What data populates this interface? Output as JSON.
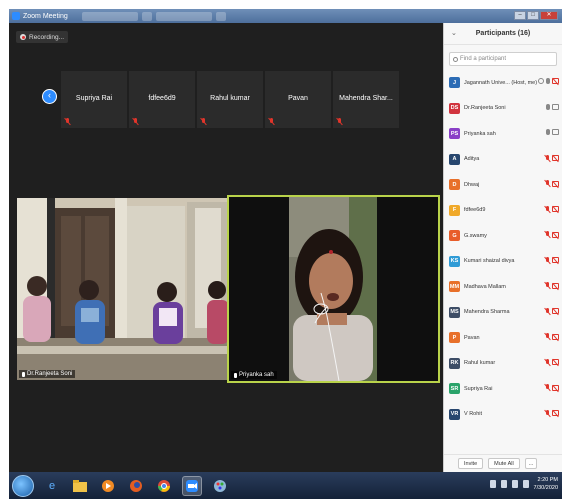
{
  "window": {
    "title": "Zoom Meeting"
  },
  "recording": {
    "label": "Recording..."
  },
  "thumbnails": [
    {
      "name": "Supriya Rai"
    },
    {
      "name": "fdfee6d9"
    },
    {
      "name": "Rahul kumar"
    },
    {
      "name": "Pavan"
    },
    {
      "name": "Mahendra  Shar..."
    }
  ],
  "videos": [
    {
      "label": "Dr.Ranjeeta Soni"
    },
    {
      "label": "Priyanka sah"
    }
  ],
  "panel": {
    "title": "Participants (16)",
    "search_placeholder": "Find a participant",
    "invite_label": "Invite",
    "mute_all_label": "Mute All",
    "more_label": "...",
    "participants": [
      {
        "initials": "J",
        "name": "Jagannath Unive... (Host, me)",
        "color": "#2c6cb5",
        "mic": "on",
        "cam": "off",
        "host": true
      },
      {
        "initials": "DS",
        "name": "Dr.Ranjeeta Soni",
        "color": "#d1343e",
        "mic": "on",
        "cam": "on"
      },
      {
        "initials": "PS",
        "name": "Priyanka sah",
        "color": "#8a3fc7",
        "mic": "on",
        "cam": "on"
      },
      {
        "initials": "A",
        "name": "Aditya",
        "color": "#27466e",
        "mic": "off",
        "cam": "off"
      },
      {
        "initials": "D",
        "name": "Dhwaj",
        "color": "#e8702a",
        "mic": "off",
        "cam": "off"
      },
      {
        "initials": "F",
        "name": "fdfee6d9",
        "color": "#f0a92a",
        "mic": "off",
        "cam": "off"
      },
      {
        "initials": "G",
        "name": "G.swamy",
        "color": "#e85d2a",
        "mic": "off",
        "cam": "off"
      },
      {
        "initials": "KS",
        "name": "Kumari shaizal divya",
        "color": "#2f9bd6",
        "mic": "off",
        "cam": "off"
      },
      {
        "initials": "MM",
        "name": "Madhava Mallam",
        "color": "#e8702a",
        "mic": "off",
        "cam": "off"
      },
      {
        "initials": "MS",
        "name": "Mahendra Sharma",
        "color": "#3d4d66",
        "mic": "off",
        "cam": "off"
      },
      {
        "initials": "P",
        "name": "Pavan",
        "color": "#e8702a",
        "mic": "off",
        "cam": "off"
      },
      {
        "initials": "RK",
        "name": "Rahul kumar",
        "color": "#3d4d66",
        "mic": "off",
        "cam": "off"
      },
      {
        "initials": "SR",
        "name": "Supriya Rai",
        "color": "#2aa36a",
        "mic": "off",
        "cam": "off"
      },
      {
        "initials": "VR",
        "name": "V Rohit",
        "color": "#27466e",
        "mic": "off",
        "cam": "off"
      }
    ]
  },
  "taskbar": {
    "clock_time": "2:20 PM",
    "clock_date": "7/30/2020"
  }
}
